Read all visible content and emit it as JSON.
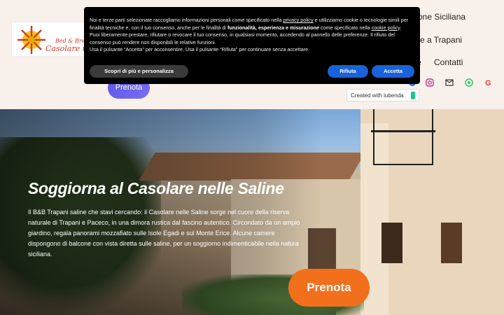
{
  "header": {
    "logo": {
      "line1": "Bed & Breakfast",
      "line2": "Casolare nelle"
    },
    "nav": [
      "one Siciliana",
      "re a Trapani",
      "e",
      "Contatti"
    ],
    "prenota_label": "Prenota",
    "social_icons": [
      "facebook-icon",
      "instagram-icon",
      "email-icon",
      "whatsapp-icon",
      "google-icon"
    ]
  },
  "iubenda": {
    "text": "Created with iubenda"
  },
  "cookie_banner": {
    "text_part1": "Noi e terze parti selezionate raccogliamo informazioni personali come specificato nella",
    "privacy_link": "privacy policy",
    "text_part2": "e utilizziamo cookie o tecnologie simili per finalità tecniche e, con il tuo consenso, anche per le finalità di",
    "text_bold": "funzionalità, esperienza e misurazione",
    "text_part3": "come specificato nella",
    "cookie_link": "cookie policy",
    "text_part4": "Puoi liberamente prestare, rifiutare o revocare il tuo consenso, in qualsiasi momento, accedendo al pannello delle preferenze. Il rifiuto del consenso può rendere non disponibili le relative funzioni.",
    "text_part5": "Usa il pulsante “Accetta” per acconsentire. Usa il pulsante “Rifiuta” per continuare senza accettare.",
    "more_label": "Scopri di più e personalizza",
    "reject_label": "Rifiuta",
    "accept_label": "Accetta"
  },
  "hero": {
    "title": "Soggiorna al Casolare nelle Saline",
    "text": "Il B&B Trapani saline che stavi cercando: il Casolare nelle Saline sorge nel cuore della riserva naturale di Trapani e Paceco, in una dimora rustica dal fascino autentico. Circondato da un ampio giardino, regala panorami mozzafiato sulle Isole Egadi e sul Monte Erice. Alcune camere dispongono di balcone con vista diretta sulle saline, per un soggiorno indimenticabile nella natura siciliana.",
    "prenota_label": "Prenota"
  },
  "colors": {
    "accent_orange": "#f26f1c",
    "accent_purple": "#5b57e8",
    "iubenda_blue": "#1863dc"
  }
}
